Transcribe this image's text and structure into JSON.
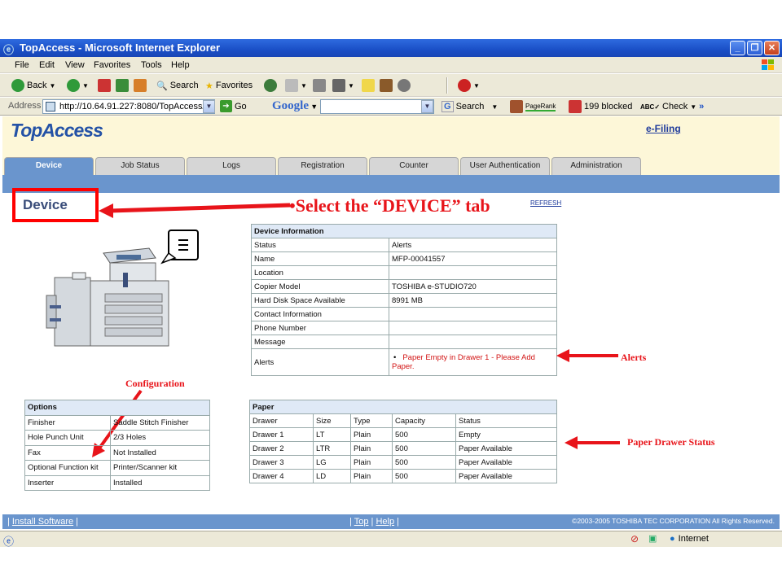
{
  "window": {
    "title": "TopAccess - Microsoft Internet Explorer",
    "minimize": "_",
    "maximize": "❐",
    "close": "✕"
  },
  "menu": [
    "File",
    "Edit",
    "View",
    "Favorites",
    "Tools",
    "Help"
  ],
  "toolbar": {
    "back": "Back",
    "search": "Search",
    "favorites": "Favorites"
  },
  "address": {
    "label": "Address",
    "url": "http://10.64.91.227:8080/TopAccess/",
    "go": "Go",
    "google": "Google",
    "g_search": "Search",
    "pagerank": "PageRank",
    "blocked": "199 blocked",
    "check": "Check"
  },
  "page": {
    "logo": "TopAccess",
    "efiling": "e-Filing",
    "tabs": [
      "Device",
      "Job Status",
      "Logs",
      "Registration",
      "Counter",
      "User Authentication",
      "Administration"
    ],
    "active_tab": "Device",
    "heading": "Device",
    "refresh": "REFRESH"
  },
  "annotations": {
    "select_tab": "•Select the “DEVICE” tab",
    "alerts": "Alerts",
    "configuration": "Configuration",
    "paper_status": "Paper Drawer Status"
  },
  "device_info": {
    "title": "Device Information",
    "rows": [
      [
        "Status",
        "Alerts"
      ],
      [
        "Name",
        "MFP-00041557"
      ],
      [
        "Location",
        ""
      ],
      [
        "Copier Model",
        "TOSHIBA e-STUDIO720"
      ],
      [
        "Hard Disk Space Available",
        "8991 MB"
      ],
      [
        "Contact Information",
        ""
      ],
      [
        "Phone Number",
        ""
      ],
      [
        "Message",
        ""
      ]
    ],
    "alerts_label": "Alerts",
    "alerts_value": "Paper Empty in Drawer 1 - Please Add Paper."
  },
  "options": {
    "title": "Options",
    "rows": [
      [
        "Finisher",
        "Saddle Stitch Finisher"
      ],
      [
        "Hole Punch Unit",
        "2/3 Holes"
      ],
      [
        "Fax",
        "Not Installed"
      ],
      [
        "Optional Function kit",
        "Printer/Scanner kit"
      ],
      [
        "Inserter",
        "Installed"
      ]
    ]
  },
  "paper": {
    "title": "Paper",
    "columns": [
      "Drawer",
      "Size",
      "Type",
      "Capacity",
      "Status"
    ],
    "rows": [
      [
        "Drawer 1",
        "LT",
        "Plain",
        "500",
        "Empty"
      ],
      [
        "Drawer 2",
        "LTR",
        "Plain",
        "500",
        "Paper Available"
      ],
      [
        "Drawer 3",
        "LG",
        "Plain",
        "500",
        "Paper Available"
      ],
      [
        "Drawer 4",
        "LD",
        "Plain",
        "500",
        "Paper Available"
      ]
    ]
  },
  "footer": {
    "install": "Install Software",
    "top": "Top",
    "help": "Help",
    "copyright": "©2003-2005 TOSHIBA TEC CORPORATION All Rights Reserved."
  },
  "status": {
    "zone": "Internet"
  },
  "colors": {
    "accent": "#6a95cd",
    "annotation_red": "#e8141a",
    "alert_red": "#d21414"
  }
}
